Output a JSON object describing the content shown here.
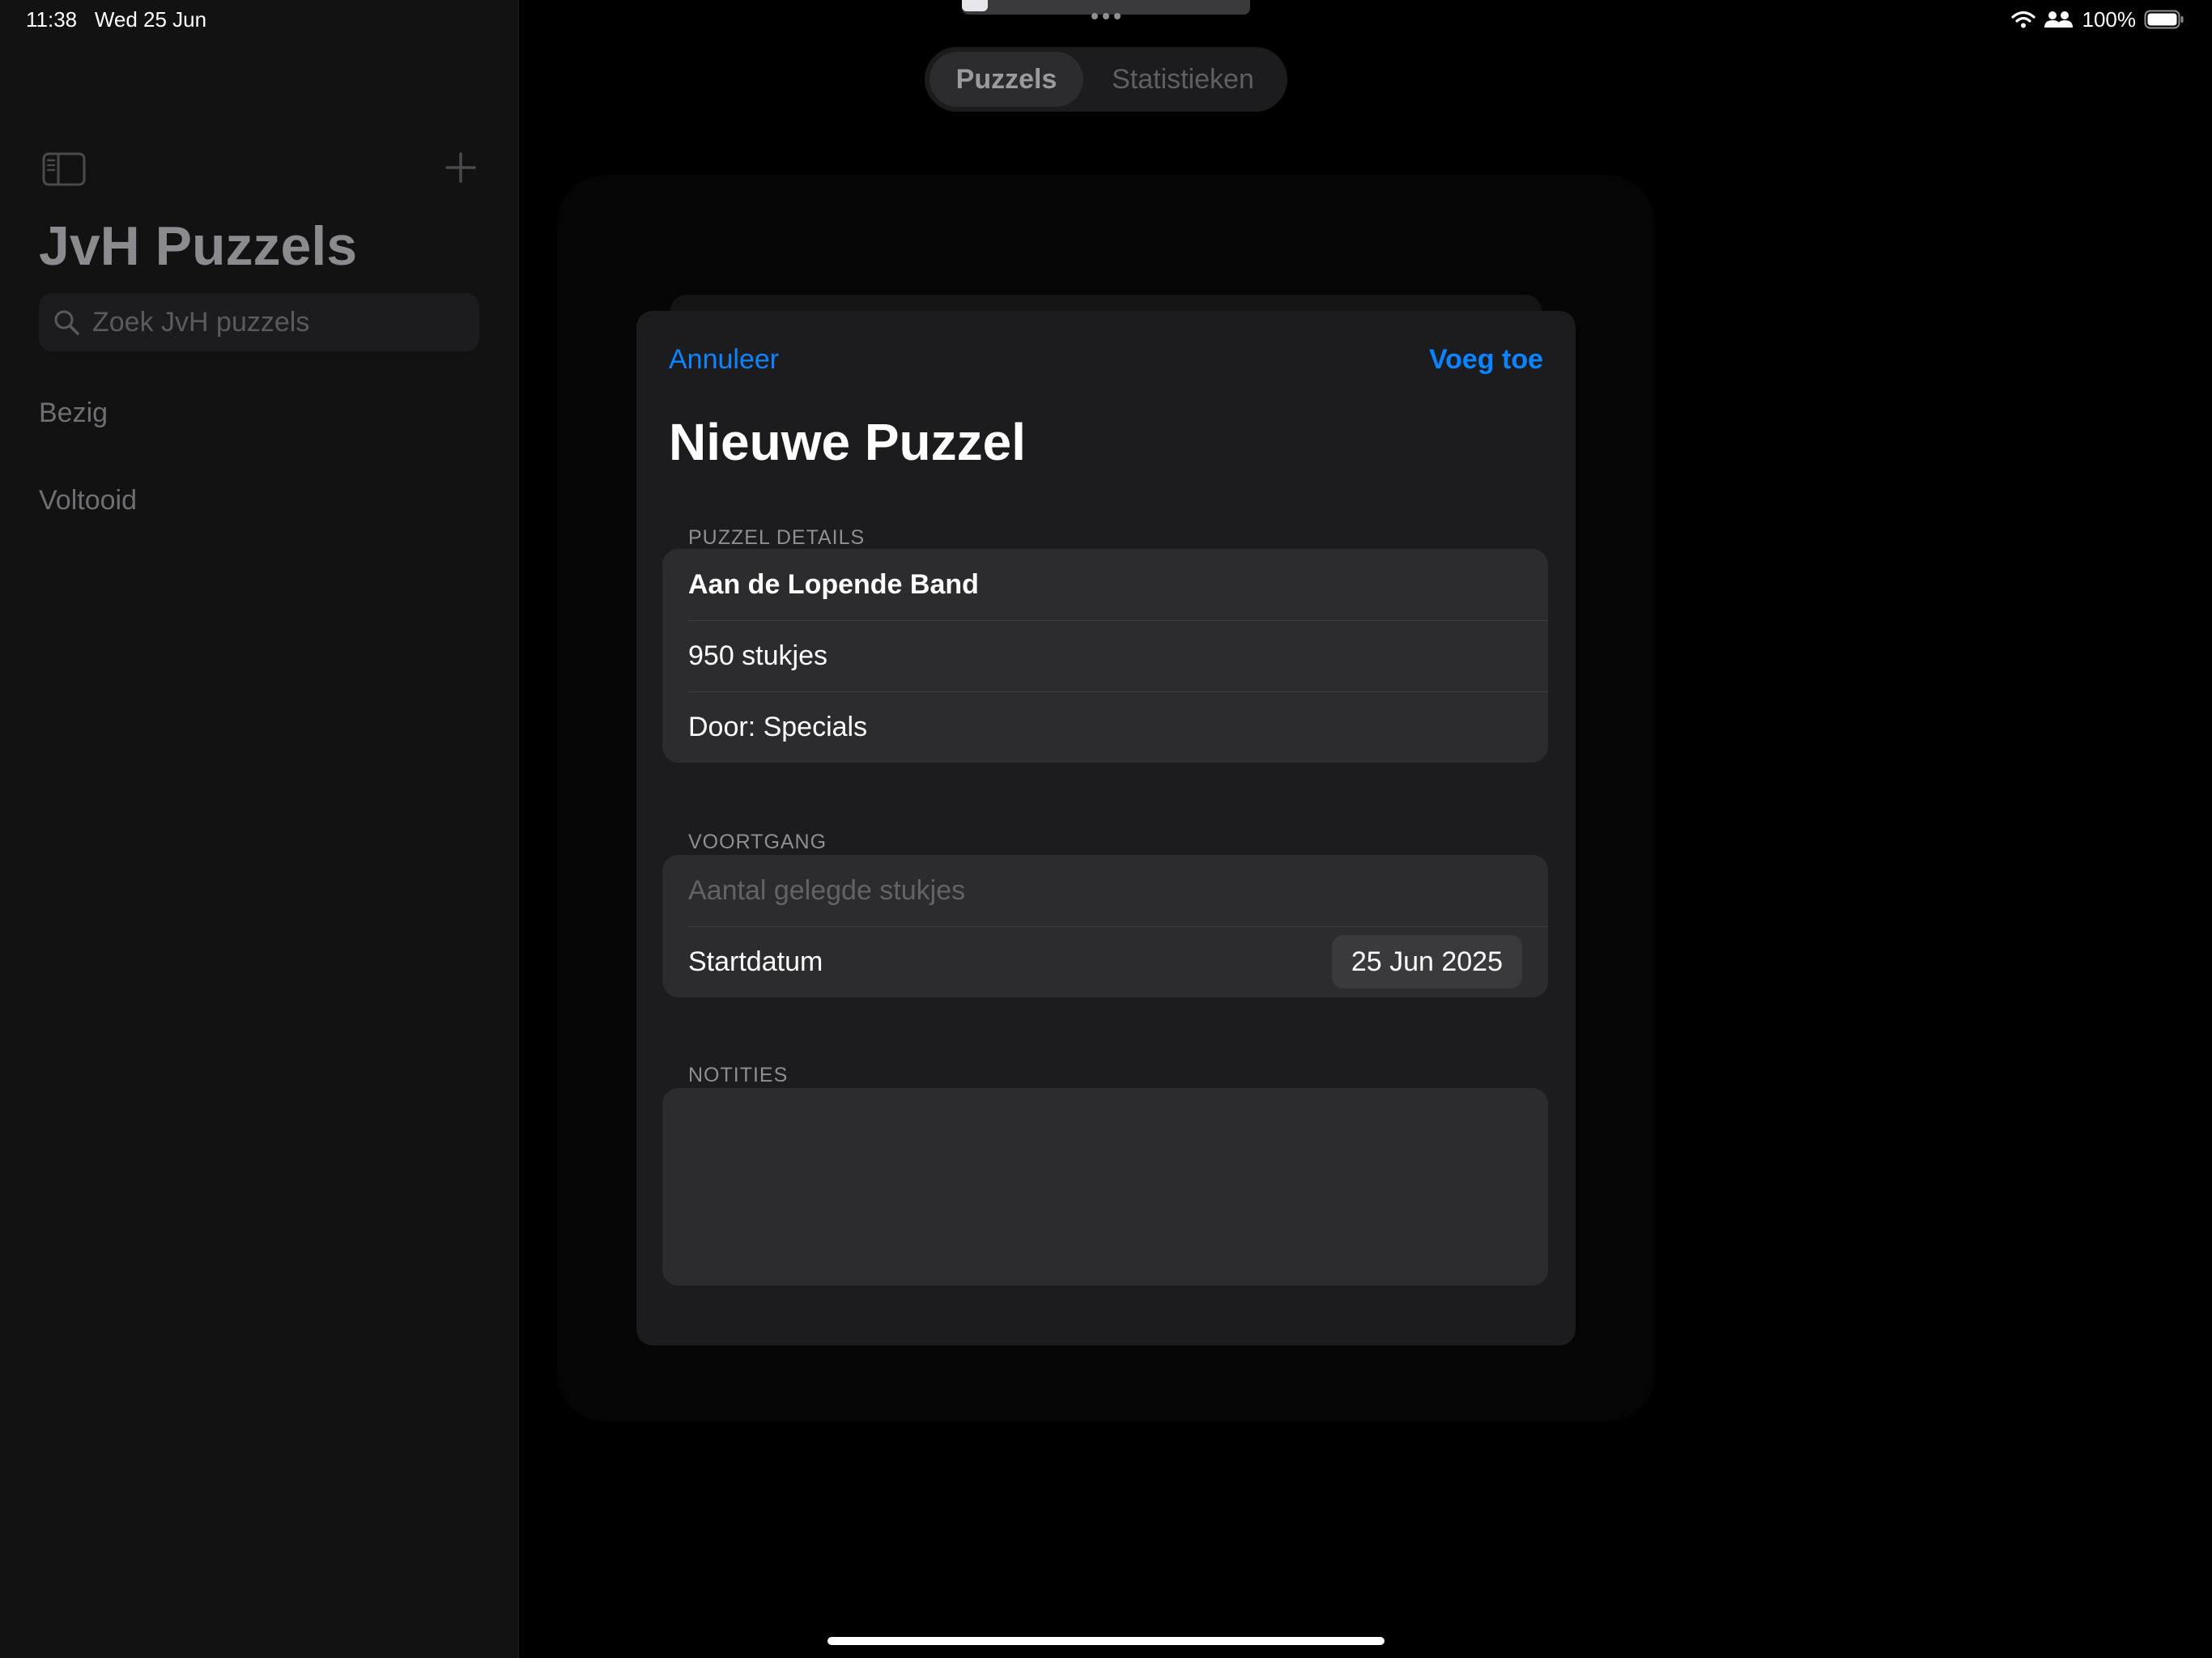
{
  "status_bar": {
    "time": "11:38",
    "date": "Wed 25 Jun",
    "battery": "100%"
  },
  "sidebar": {
    "title": "JvH Puzzels",
    "search_placeholder": "Zoek JvH puzzels",
    "items": [
      {
        "label": "Bezig"
      },
      {
        "label": "Voltooid"
      }
    ]
  },
  "segmented": {
    "tabs": [
      {
        "label": "Puzzels",
        "selected": true
      },
      {
        "label": "Statistieken",
        "selected": false
      }
    ]
  },
  "sheet": {
    "cancel_label": "Annuleer",
    "add_label": "Voeg toe",
    "title": "Nieuwe Puzzel",
    "details": {
      "header": "PUZZEL DETAILS",
      "name": "Aan de Lopende Band",
      "pieces": "950 stukjes",
      "author": "Door: Specials"
    },
    "progress": {
      "header": "VOORTGANG",
      "placed_placeholder": "Aantal gelegde stukjes",
      "start_label": "Startdatum",
      "start_value": "25 Jun 2025"
    },
    "notes": {
      "header": "NOTITIES",
      "value": ""
    }
  },
  "icons": {
    "sidebar_toggle": "sidebar-left-icon",
    "add": "plus-icon",
    "search": "magnifying-glass-icon",
    "wifi": "wifi-icon",
    "people": "person-2-icon",
    "battery": "battery-full-icon"
  },
  "colors": {
    "accent": "#0a84ff",
    "background": "#000000",
    "sidebar": "#121212",
    "sheet": "#1c1c1e",
    "group": "#2c2c2e"
  }
}
